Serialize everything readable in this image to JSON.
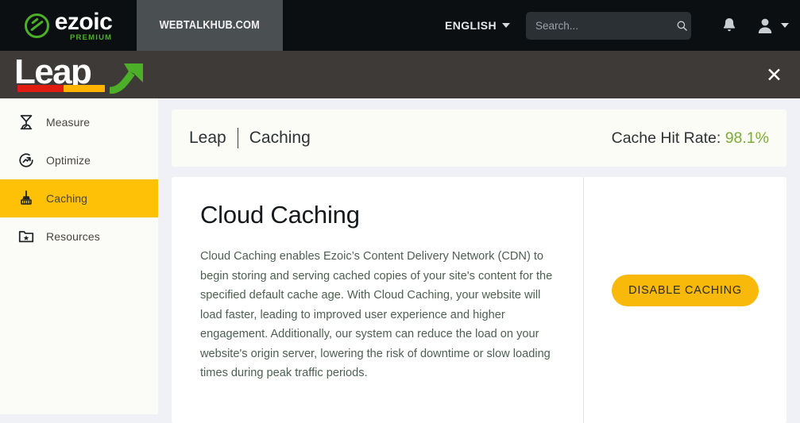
{
  "topnav": {
    "brand": {
      "word": "ezoic",
      "sub": "PREMIUM",
      "icon": "ezoic-logo-icon"
    },
    "site_tab": {
      "label": "WEBTALKHUB.COM"
    },
    "language": {
      "label": "ENGLISH",
      "caret_icon": "chevron-down-icon"
    },
    "search": {
      "value": "",
      "placeholder": "Search...",
      "icon": "search-icon"
    },
    "notifications": {
      "icon": "bell-icon"
    },
    "account": {
      "icon": "user-avatar-icon",
      "caret_icon": "chevron-down-icon"
    }
  },
  "leapbar": {
    "logo_word": "Leap",
    "arrow_icon": "green-growth-arrow-icon",
    "close_label": "✕",
    "close_icon": "close-icon"
  },
  "sidebar": {
    "items": [
      {
        "label": "Measure",
        "icon": "measure-gauge-icon",
        "active": false
      },
      {
        "label": "Optimize",
        "icon": "optimize-arrow-circle-icon",
        "active": false
      },
      {
        "label": "Caching",
        "icon": "broom-icon",
        "active": true
      },
      {
        "label": "Resources",
        "icon": "folder-star-icon",
        "active": false
      }
    ]
  },
  "main": {
    "breadcrumb": {
      "root": "Leap",
      "current": "Caching"
    },
    "cache_hit_rate": {
      "label": "Cache Hit Rate:",
      "value": "98.1%",
      "value_color": "#7dab3a"
    },
    "card": {
      "title": "Cloud Caching",
      "body": "Cloud Caching enables Ezoic’s Content Delivery Network (CDN) to begin storing and serving cached copies of your site's content for the specified default cache age. With Cloud Caching, your website will load faster, leading to improved user experience and higher engagement. Additionally, our system can reduce the load on your website's origin server, lowering the risk of downtime or slow loading times during peak traffic periods.",
      "action_label": "DISABLE CACHING"
    }
  },
  "colors": {
    "navbar_bg": "#0b0f12",
    "site_tab_bg": "#4a4f52",
    "leapbar_bg": "#3d3a37",
    "accent_yellow": "#ffc107",
    "button_yellow": "#f9b90a",
    "brand_green": "#4caf28",
    "page_bg": "#eff1f6",
    "sidebar_bg": "#fbfcf8"
  }
}
